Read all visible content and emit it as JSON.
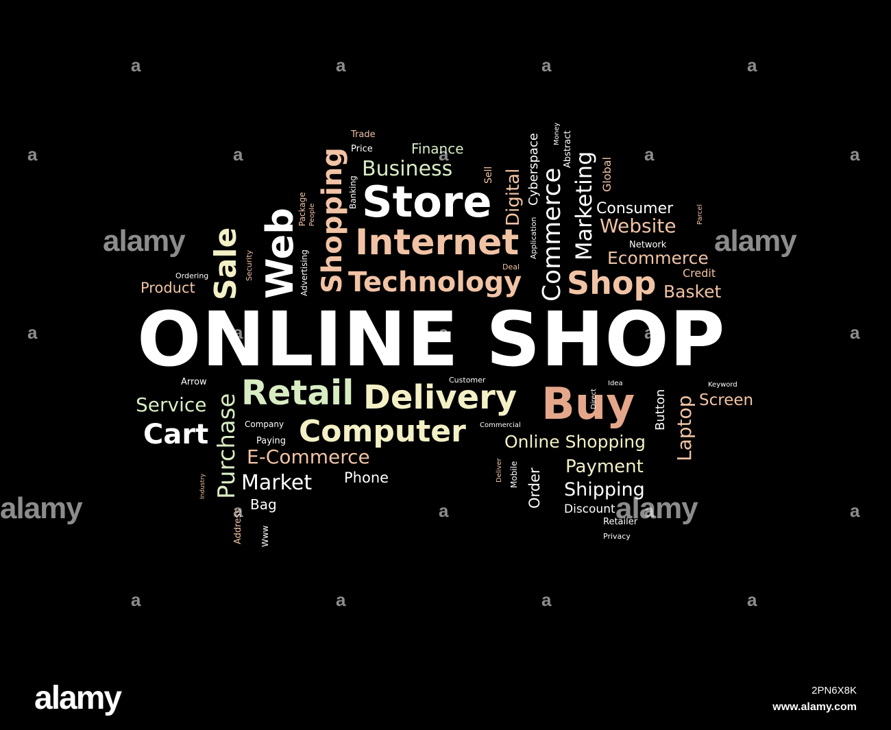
{
  "palette": {
    "white": "#ffffff",
    "cream": "#f3f0c6",
    "mint": "#d8ecc3",
    "peach": "#f1c3a5",
    "salmon": "#e4a78b",
    "background": "#000000"
  },
  "words": [
    {
      "text": "ONLINE SHOP",
      "color": "white"
    },
    {
      "text": "Store",
      "color": "white"
    },
    {
      "text": "Internet",
      "color": "peach"
    },
    {
      "text": "Technology",
      "color": "peach"
    },
    {
      "text": "Shop",
      "color": "peach"
    },
    {
      "text": "Business",
      "color": "mint"
    },
    {
      "text": "Finance",
      "color": "mint"
    },
    {
      "text": "Price",
      "color": "white"
    },
    {
      "text": "Trade",
      "color": "peach"
    },
    {
      "text": "Web",
      "color": "white"
    },
    {
      "text": "Sale",
      "color": "cream"
    },
    {
      "text": "Shopping",
      "color": "peach"
    },
    {
      "text": "Product",
      "color": "peach"
    },
    {
      "text": "Ordering",
      "color": "white"
    },
    {
      "text": "Security",
      "color": "peach"
    },
    {
      "text": "Package",
      "color": "peach"
    },
    {
      "text": "People",
      "color": "peach"
    },
    {
      "text": "Advertising",
      "color": "white"
    },
    {
      "text": "Banking",
      "color": "white"
    },
    {
      "text": "Sell",
      "color": "peach"
    },
    {
      "text": "Digital",
      "color": "peach"
    },
    {
      "text": "Cyberspace",
      "color": "white"
    },
    {
      "text": "Application",
      "color": "white"
    },
    {
      "text": "Deal",
      "color": "peach"
    },
    {
      "text": "Money",
      "color": "white"
    },
    {
      "text": "Commerce",
      "color": "white"
    },
    {
      "text": "Abstract",
      "color": "white"
    },
    {
      "text": "Marketing",
      "color": "white"
    },
    {
      "text": "Global",
      "color": "peach"
    },
    {
      "text": "Consumer",
      "color": "white"
    },
    {
      "text": "Website",
      "color": "peach"
    },
    {
      "text": "Parcel",
      "color": "peach"
    },
    {
      "text": "Network",
      "color": "white"
    },
    {
      "text": "Ecommerce",
      "color": "peach"
    },
    {
      "text": "Credit",
      "color": "peach"
    },
    {
      "text": "Basket",
      "color": "peach"
    },
    {
      "text": "Arrow",
      "color": "white"
    },
    {
      "text": "Retail",
      "color": "mint"
    },
    {
      "text": "Delivery",
      "color": "cream"
    },
    {
      "text": "Customer",
      "color": "white"
    },
    {
      "text": "Buy",
      "color": "salmon"
    },
    {
      "text": "Direct",
      "color": "white"
    },
    {
      "text": "Idea",
      "color": "white"
    },
    {
      "text": "Button",
      "color": "white"
    },
    {
      "text": "Laptop",
      "color": "peach"
    },
    {
      "text": "Keyword",
      "color": "white"
    },
    {
      "text": "Screen",
      "color": "peach"
    },
    {
      "text": "Service",
      "color": "mint"
    },
    {
      "text": "Purchase",
      "color": "mint"
    },
    {
      "text": "Cart",
      "color": "white"
    },
    {
      "text": "Company",
      "color": "white"
    },
    {
      "text": "Computer",
      "color": "cream"
    },
    {
      "text": "Commercial",
      "color": "white"
    },
    {
      "text": "Online Shopping",
      "color": "cream"
    },
    {
      "text": "Paying",
      "color": "white"
    },
    {
      "text": "E-Commerce",
      "color": "peach"
    },
    {
      "text": "Deliver",
      "color": "peach"
    },
    {
      "text": "Mobile",
      "color": "white"
    },
    {
      "text": "Order",
      "color": "white"
    },
    {
      "text": "Payment",
      "color": "cream"
    },
    {
      "text": "Industry",
      "color": "peach"
    },
    {
      "text": "Market",
      "color": "white"
    },
    {
      "text": "Phone",
      "color": "white"
    },
    {
      "text": "Shipping",
      "color": "white"
    },
    {
      "text": "Bag",
      "color": "white"
    },
    {
      "text": "Discount",
      "color": "white"
    },
    {
      "text": "Address",
      "color": "peach"
    },
    {
      "text": "Www",
      "color": "white"
    },
    {
      "text": "Retailer",
      "color": "white"
    },
    {
      "text": "Privacy",
      "color": "white"
    }
  ],
  "watermark": {
    "glyph": "a",
    "logo": "alamy",
    "image_id": "2PN6X8K",
    "url": "www.alamy.com"
  }
}
